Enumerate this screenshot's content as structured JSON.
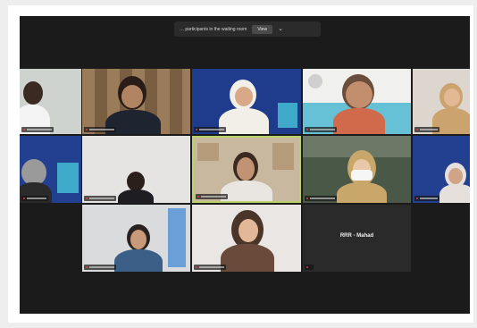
{
  "meeting": {
    "banner": {
      "message": "… participants in the waiting room",
      "view_button": "View",
      "more_icon": "chevron-down-icon"
    },
    "tiles": [
      {
        "id": 1,
        "video": true
      },
      {
        "id": 2,
        "video": true
      },
      {
        "id": 3,
        "video": true
      },
      {
        "id": 4,
        "video": true
      },
      {
        "id": 5,
        "video": true
      },
      {
        "id": 6,
        "video": true
      },
      {
        "id": 7,
        "video": true
      },
      {
        "id": 8,
        "video": true,
        "active_speaker": true
      },
      {
        "id": 9,
        "video": true
      },
      {
        "id": 10,
        "video": true
      },
      {
        "id": 11,
        "video": true
      },
      {
        "id": 12,
        "video": true
      },
      {
        "id": 13,
        "video": false,
        "label": "RRR - Mahad"
      }
    ]
  },
  "colors": {
    "background": "#1b1b1b",
    "active_speaker_border": "#b9d36a",
    "banner_bg": "#1f3c8c"
  }
}
